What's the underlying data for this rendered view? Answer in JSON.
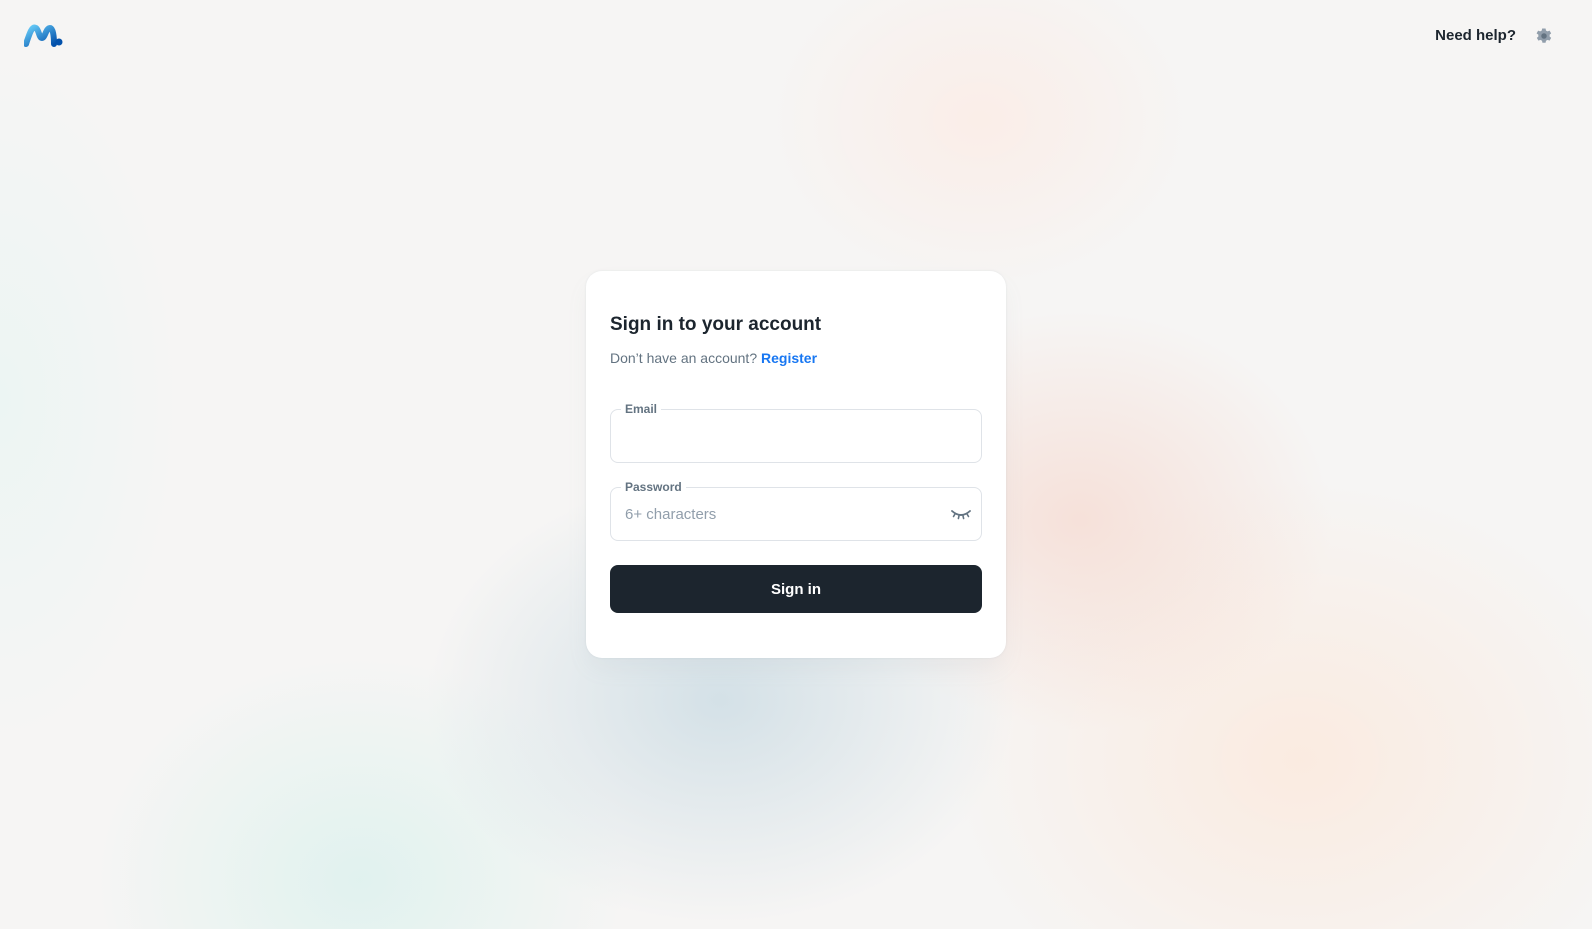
{
  "header": {
    "logo_icon": "logo-icon",
    "help_label": "Need help?",
    "settings_icon": "gear-icon"
  },
  "signin": {
    "title": "Sign in to your account",
    "no_account_text": "Don’t have an account?",
    "register_label": "Register",
    "email": {
      "label": "Email",
      "value": "",
      "placeholder": ""
    },
    "password": {
      "label": "Password",
      "value": "",
      "placeholder": "6+ characters",
      "visibility_icon": "eye-closed-icon"
    },
    "submit_label": "Sign in"
  },
  "colors": {
    "primary_text": "#1c252e",
    "secondary_text": "#637381",
    "link": "#1877f2",
    "button_bg": "#1c252e",
    "logo_blue": "#1877f2"
  }
}
